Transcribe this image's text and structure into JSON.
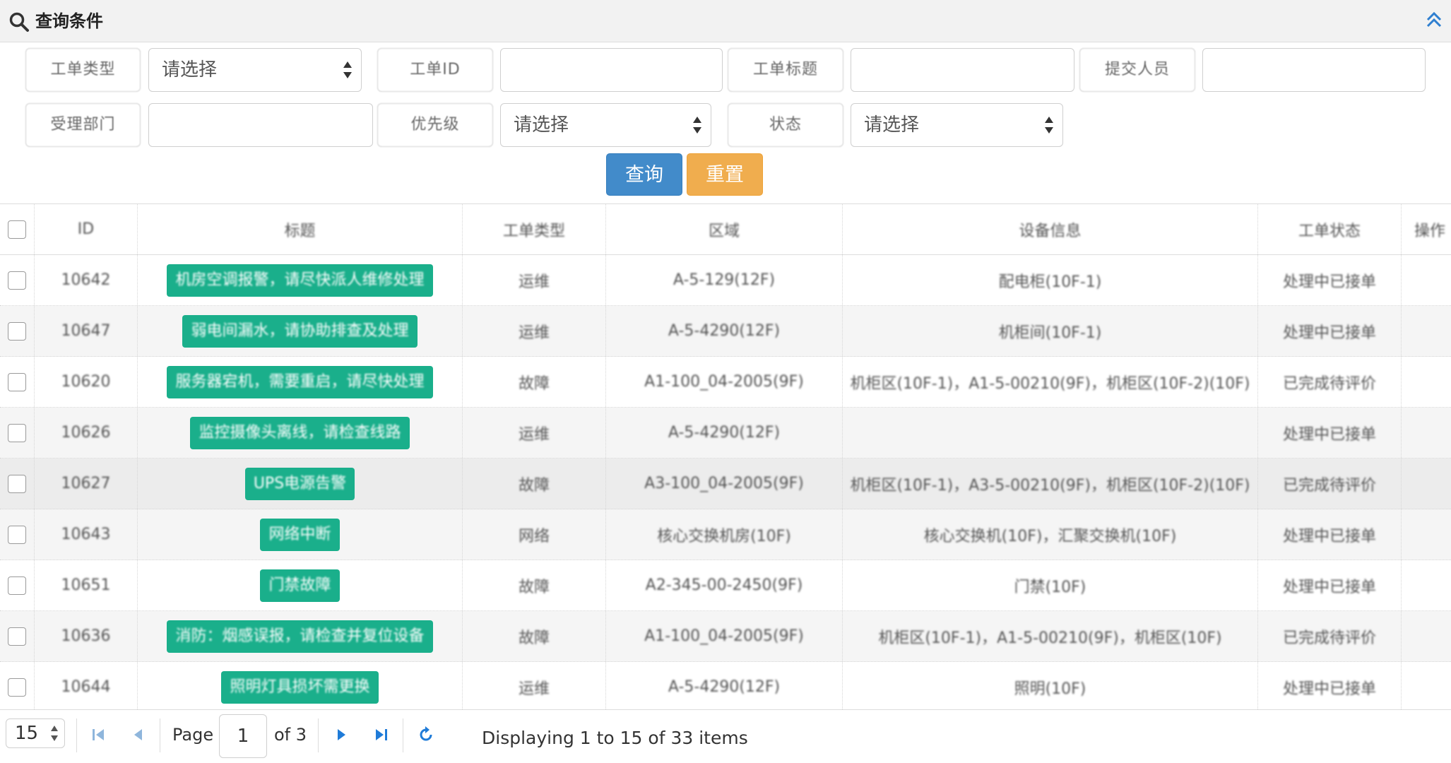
{
  "panel": {
    "title": "查询条件"
  },
  "filters": {
    "row1": [
      {
        "label": "工单类型",
        "value": "请选择",
        "kind": "select"
      },
      {
        "label": "工单ID",
        "value": "",
        "kind": "text"
      },
      {
        "label": "工单标题",
        "value": "",
        "kind": "text"
      },
      {
        "label": "提交人员",
        "value": "",
        "kind": "text"
      }
    ],
    "row2": [
      {
        "label": "受理部门",
        "value": "",
        "kind": "text"
      },
      {
        "label": "优先级",
        "value": "请选择",
        "kind": "select"
      },
      {
        "label": "状态",
        "value": "请选择",
        "kind": "select"
      }
    ],
    "query_label": "查询",
    "reset_label": "重置"
  },
  "grid": {
    "columns": [
      "ID",
      "标题",
      "工单类型",
      "区域",
      "设备信息",
      "工单状态",
      "操作"
    ],
    "rows": [
      {
        "id": "10642",
        "title": "机房空调报警，请尽快派人维修处理",
        "type": "运维",
        "area": "A-5-129(12F)",
        "device": "配电柜(10F-1)",
        "status": "处理中已接单"
      },
      {
        "id": "10647",
        "title": "弱电间漏水，请协助排查及处理",
        "type": "运维",
        "area": "A-5-4290(12F)",
        "device": "机柜间(10F-1)",
        "status": "处理中已接单"
      },
      {
        "id": "10620",
        "title": "服务器宕机，需要重启，请尽快处理",
        "type": "故障",
        "area": "A1-100_04-2005(9F)",
        "device": "机柜区(10F-1)，A1-5-00210(9F)，机柜区(10F-2)(10F)",
        "status": "已完成待评价"
      },
      {
        "id": "10626",
        "title": "监控摄像头离线，请检查线路",
        "type": "运维",
        "area": "A-5-4290(12F)",
        "device": "",
        "status": "处理中已接单"
      },
      {
        "id": "10627",
        "title": "UPS电源告警",
        "type": "故障",
        "area": "A3-100_04-2005(9F)",
        "device": "机柜区(10F-1)，A3-5-00210(9F)，机柜区(10F-2)(10F)",
        "status": "已完成待评价"
      },
      {
        "id": "10643",
        "title": "网络中断",
        "type": "网络",
        "area": "核心交换机房(10F)",
        "device": "核心交换机(10F)，汇聚交换机(10F)",
        "status": "处理中已接单"
      },
      {
        "id": "10651",
        "title": "门禁故障",
        "type": "故障",
        "area": "A2-345-00-2450(9F)",
        "device": "门禁(10F)",
        "status": "处理中已接单"
      },
      {
        "id": "10636",
        "title": "消防：烟感误报，请检查并复位设备",
        "type": "故障",
        "area": "A1-100_04-2005(9F)",
        "device": "机柜区(10F-1)，A1-5-00210(9F)，机柜区(10F)",
        "status": "已完成待评价"
      },
      {
        "id": "10644",
        "title": "照明灯具损坏需更换",
        "type": "运维",
        "area": "A-5-4290(12F)",
        "device": "照明(10F)",
        "status": "处理中已接单"
      }
    ]
  },
  "pager": {
    "page_size": "15",
    "page_label": "Page",
    "page_value": "1",
    "of_label": "of 3",
    "display_text": "Displaying 1 to 15 of 33 items"
  }
}
